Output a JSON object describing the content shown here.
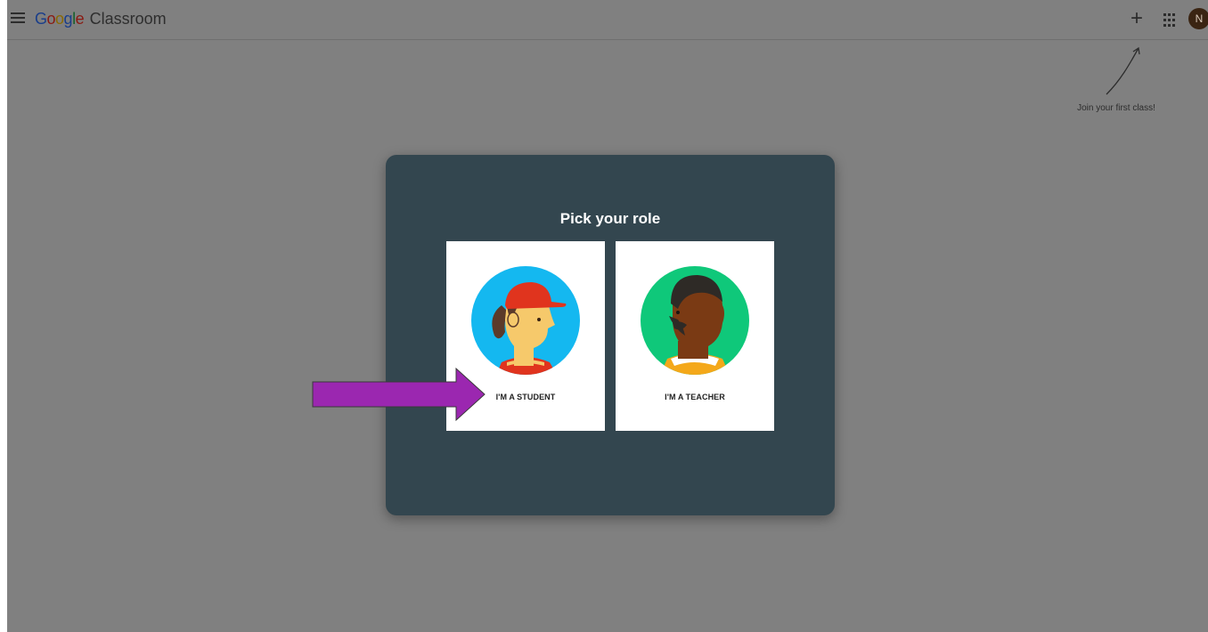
{
  "header": {
    "logo_word": "Google",
    "product_name": "Classroom",
    "avatar_initial": "N",
    "icons": [
      "menu-icon",
      "plus-icon",
      "apps-grid-icon"
    ]
  },
  "hint": {
    "text": "Join your first class!"
  },
  "dialog": {
    "title": "Pick your role",
    "student_label": "I'M A STUDENT",
    "teacher_label": "I'M A TEACHER"
  },
  "colors": {
    "overlay": "#808080",
    "dialog_bg": "#33464f",
    "student_circle": "#14b8f0",
    "teacher_circle": "#0fc87a",
    "annotation_arrow": "#9b27b0"
  }
}
